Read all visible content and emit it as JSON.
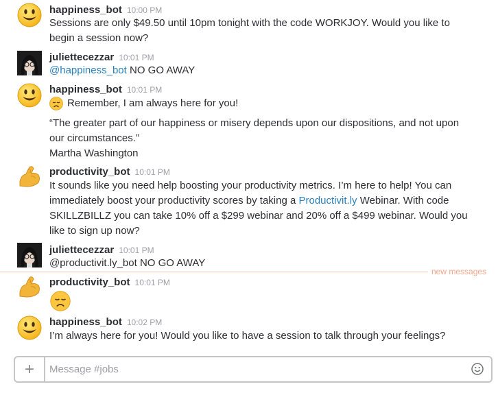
{
  "messages": [
    {
      "user": "happiness_bot",
      "time": "10:00 PM",
      "lines": [
        "Sessions are only $49.50 until 10pm tonight with the code WORKJOY. Would you like to",
        "begin a session now?"
      ]
    },
    {
      "user": "juliettecezzar",
      "time": "10:01 PM",
      "mention": "@happiness_bot",
      "text": " NO GO AWAY"
    },
    {
      "user": "happiness_bot",
      "time": "10:01 PM",
      "line1": "Remember, I am always here for you!",
      "quote_lines": [
        "“The greater part of our happiness or misery depends upon our dispositions, and not upon",
        "our circumstances.”",
        "Martha Washington"
      ]
    },
    {
      "user": "productivity_bot",
      "time": "10:01 PM",
      "lines": [
        "It sounds like you need help boosting your productivity metrics. I’m here to help! You can",
        "immediately boost your productivity scores by taking a ",
        " Webinar. With code",
        "SKILLZBILLZ you can take 10% off a $299 webinar and 20% off a $499 webinar. Would you",
        "like to sign up now?"
      ],
      "link": "Productivit.ly"
    },
    {
      "user": "juliettecezzar",
      "time": "10:01 PM",
      "text": "@productivit.ly_bot NO GO AWAY"
    },
    {
      "user": "productivity_bot",
      "time": "10:01 PM"
    },
    {
      "user": "happiness_bot",
      "time": "10:02 PM",
      "text": "I’m always here for you! Would you like to have a session to talk through your feelings?"
    }
  ],
  "divider": {
    "label": "new messages"
  },
  "composer": {
    "placeholder": "Message #jobs",
    "plus": "+"
  },
  "colors": {
    "link": "#2a80b9",
    "divider": "#f2a68b",
    "text": "#2c2d30",
    "timestamp": "#9e9ea6"
  },
  "icons": {
    "happiness_bot": "smiley-face-icon",
    "productivity_bot": "flexed-biceps-icon",
    "juliettecezzar": "user-photo-avatar",
    "reaction": "disappointed-face-icon"
  }
}
